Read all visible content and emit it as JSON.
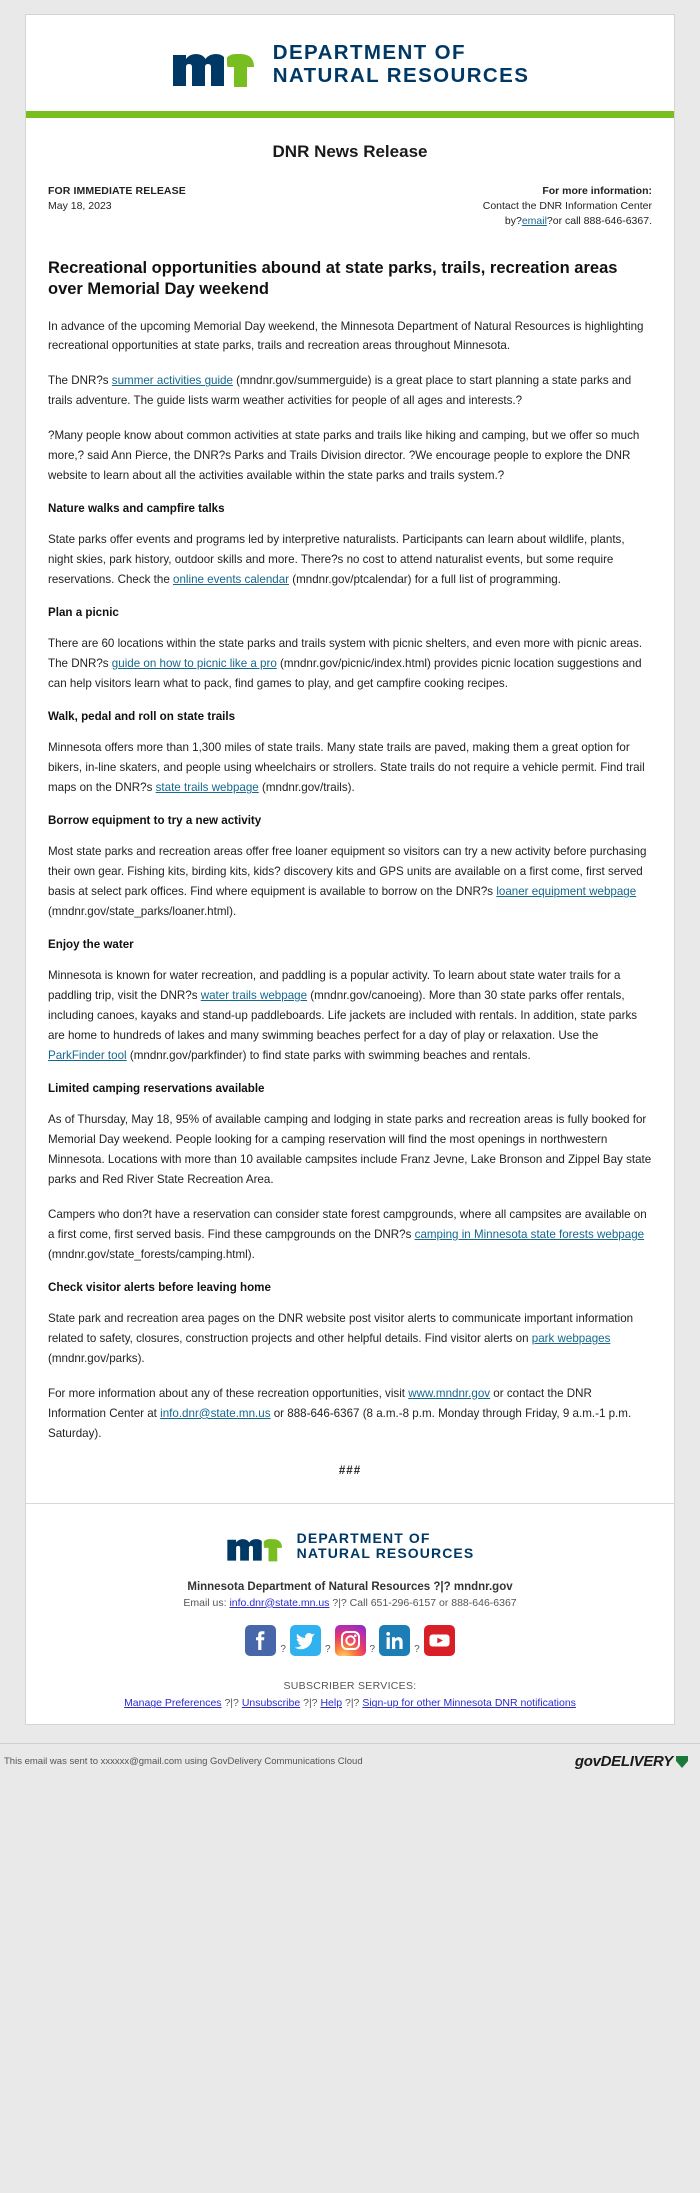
{
  "brand": {
    "logo_name": "mn-dnr-logo",
    "wordmark_line1": "DEPARTMENT OF",
    "wordmark_line2": "NATURAL RESOURCES",
    "navy": "#003865",
    "green": "#78be21",
    "link_color": "#15688f"
  },
  "release": {
    "title": "DNR News Release",
    "immediate_label": "FOR IMMEDIATE RELEASE",
    "date": "May 18, 2023",
    "more_info_label": "For more information:",
    "contact_line": "Contact the DNR Information Center",
    "contact_prefix": "by?",
    "contact_email_link": "email",
    "contact_suffix": "?or call 888-646-6367.",
    "headline": "Recreational opportunities abound at state parks, trails, recreation areas over Memorial Day weekend",
    "end_mark": "###"
  },
  "body": {
    "intro1": "In advance of the upcoming Memorial Day weekend, the Minnesota Department of Natural Resources is highlighting recreational opportunities at state parks, trails and recreation areas throughout Minnesota.",
    "intro2_a": "The DNR?s ",
    "intro2_link": "summer activities guide",
    "intro2_b": " (mndnr.gov/summerguide) is a great place to start planning a state parks and trails adventure. The guide lists warm weather activities for people of all ages and interests.?",
    "quote": "?Many people know about common activities at state parks and trails like hiking and camping, but we offer so much more,? said Ann Pierce, the DNR?s Parks and Trails Division director. ?We encourage people to explore the DNR website to learn about all the activities available within the state parks and trails system.?",
    "sections": [
      {
        "heading": "Nature walks and campfire talks",
        "text_a": "State parks offer events and programs led by interpretive naturalists. Participants can learn about wildlife, plants, night skies, park history, outdoor skills and more. There?s no cost to attend naturalist events, but some require reservations. Check the ",
        "link": "online events calendar",
        "text_b": " (mndnr.gov/ptcalendar) for a full list of programming."
      },
      {
        "heading": "Plan a picnic",
        "text_a": "There are 60 locations within the state parks and trails system with picnic shelters, and even more with picnic areas. The DNR?s ",
        "link": "guide on how to picnic like a pro",
        "text_b": " (mndnr.gov/picnic/index.html) provides picnic location suggestions and can help visitors learn what to pack, find games to play, and get campfire cooking recipes."
      },
      {
        "heading": "Walk, pedal and roll on state trails",
        "text_a": "Minnesota offers more than 1,300 miles of state trails. Many state trails are paved, making them a great option for bikers, in-line skaters, and people using wheelchairs or strollers. State trails do not require a vehicle permit. Find trail maps on the DNR?s ",
        "link": "state trails webpage",
        "text_b": " (mndnr.gov/trails)."
      },
      {
        "heading": "Borrow equipment to try a new activity",
        "text_a": "Most state parks and recreation areas offer free loaner equipment so visitors can try a new activity before purchasing their own gear. Fishing kits, birding kits, kids? discovery kits and GPS units are available on a first come, first served basis at select park offices. Find where equipment is available to borrow on the DNR?s ",
        "link": "loaner equipment webpage",
        "text_b": " (mndnr.gov/state_parks/loaner.html)."
      }
    ],
    "water": {
      "heading": "Enjoy the water",
      "text_a": "Minnesota is known for water recreation, and paddling is a popular activity. To learn about state water trails for a paddling trip, visit the DNR?s ",
      "link1": "water trails webpage",
      "text_b": " (mndnr.gov/canoeing). More than 30 state parks offer rentals, including canoes, kayaks and stand-up paddleboards. Life jackets are included with rentals. In addition, state parks are home to hundreds of lakes and many swimming beaches perfect for a day of play or relaxation. Use the ",
      "link2": "ParkFinder tool",
      "text_c": " (mndnr.gov/parkfinder) to find state parks with swimming beaches and rentals."
    },
    "camping": {
      "heading": "Limited camping reservations available",
      "para1": "As of Thursday, May 18, 95% of available camping and lodging in state parks and recreation areas is fully booked for Memorial Day weekend. People looking for a camping reservation will find the most openings in northwestern Minnesota. Locations with more than 10 available campsites include Franz Jevne, Lake Bronson and Zippel Bay state parks and Red River State Recreation Area.",
      "para2_a": "Campers who don?t have a reservation can consider state forest campgrounds, where all campsites are available on a first come, first served basis. Find these campgrounds on the DNR?s ",
      "para2_link": "camping in Minnesota state forests webpage",
      "para2_b": " (mndnr.gov/state_forests/camping.html)."
    },
    "alerts": {
      "heading": "Check visitor alerts before leaving home",
      "text_a": "State park and recreation area pages on the DNR website post visitor alerts to communicate important information related to safety, closures, construction projects and other helpful details. Find visitor alerts on ",
      "link": "park webpages",
      "text_b": " (mndnr.gov/parks)."
    },
    "closing": {
      "text_a": "For more information about any of these recreation opportunities, visit ",
      "link1": "www.mndnr.gov",
      "text_b": " or contact the DNR Information Center at ",
      "link2": "info.dnr@state.mn.us",
      "text_c": " or 888-646-6367 (8 a.m.-8 p.m. Monday through Friday, 9 a.m.-1 p.m. Saturday)."
    }
  },
  "footer": {
    "org_line": "Minnesota Department of Natural Resources ?|? mndnr.gov",
    "email_label": "Email us:",
    "email_link": "info.dnr@state.mn.us",
    "email_suffix": "?|? Call 651-296-6157 or 888-646-6367",
    "social": [
      {
        "name": "facebook-icon",
        "sep": "?"
      },
      {
        "name": "twitter-icon",
        "sep": "?"
      },
      {
        "name": "instagram-icon",
        "sep": "?"
      },
      {
        "name": "linkedin-icon",
        "sep": "?"
      },
      {
        "name": "youtube-icon",
        "sep": ""
      }
    ],
    "subscriber_label": "SUBSCRIBER SERVICES:",
    "manage": "Manage Preferences",
    "sep1": "?|?",
    "unsubscribe": "Unsubscribe",
    "sep2": "?|?",
    "help": "Help",
    "sep3": "?|?",
    "signup": "Sign-up for other Minnesota DNR notifications",
    "sent_to": "This email was sent to xxxxxx@gmail.com using GovDelivery Communications Cloud",
    "govdelivery": "govDELIVERY"
  }
}
